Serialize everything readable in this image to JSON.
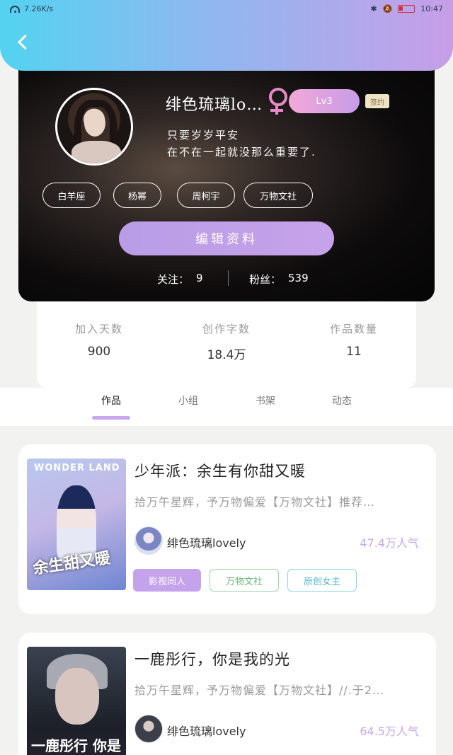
{
  "status_bar": {
    "speed": "7.26K/s",
    "time": "10:47"
  },
  "profile": {
    "username": "绯色琉璃lo…",
    "level": "Lv3",
    "sign_badge": "签约",
    "bio_line1": "只要岁岁平安",
    "bio_line2": "在不在一起就没那么重要了.",
    "tags": [
      "白羊座",
      "杨幂",
      "周柯宇",
      "万物文社"
    ],
    "edit_button": "编辑资料",
    "following_label": "关注：",
    "following_value": "9",
    "fans_label": "粉丝：",
    "fans_value": "539"
  },
  "stats": [
    {
      "label": "加入天数",
      "value": "900"
    },
    {
      "label": "创作字数",
      "value": "18.4万"
    },
    {
      "label": "作品数量",
      "value": "11"
    }
  ],
  "tabs": [
    "作品",
    "小组",
    "书架",
    "动态"
  ],
  "works": [
    {
      "title": "少年派：余生有你甜又暖",
      "description": "拾万午星辉，予万物偏爱【万物文社】推荐…",
      "author": "绯色琉璃lovely",
      "popularity": "47.4万人气",
      "cover_top_text": "WONDER LAND",
      "cover_title": "余生甜又暖",
      "tags": [
        "影视同人",
        "万物文社",
        "原创女主"
      ]
    },
    {
      "title": "一鹿彤行，你是我的光",
      "description": "拾万午星辉，予万物偏爱【万物文社】//.于2…",
      "author": "绯色琉璃lovely",
      "popularity": "64.5万人气",
      "cover_title": "一鹿彤行 你是我的光"
    }
  ],
  "colors": {
    "accent": "#c5a3ec",
    "header_gradient": [
      "#53d3f0",
      "#c79ee8"
    ]
  }
}
